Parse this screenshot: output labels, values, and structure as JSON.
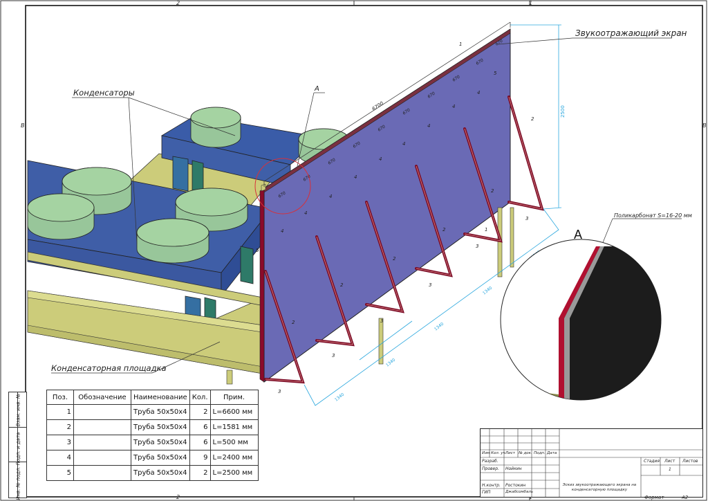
{
  "title_labels": {
    "screen": "Звукоотражающий экран",
    "condensers": "Конденсаторы",
    "platform": "Конденсаторная площадка",
    "detail_letter": "A",
    "polycarbonate": "Поликарбонат S=16-20 мм"
  },
  "dimensions": {
    "length": "6700",
    "height": "2500",
    "step": "670",
    "bay": "1340"
  },
  "position_tags": [
    "1",
    "2",
    "3",
    "4",
    "5"
  ],
  "frame_numbers": {
    "top_2": "2",
    "top_1": "1",
    "left_B": "В"
  },
  "spec": {
    "headers": [
      "Поз.",
      "Обозначение",
      "Наименование",
      "Кол.",
      "Прим."
    ],
    "rows": [
      {
        "pos": "1",
        "designation": "",
        "name": "Труба 50х50х4",
        "qty": "2",
        "note": "L=6600 мм"
      },
      {
        "pos": "2",
        "designation": "",
        "name": "Труба 50х50х4",
        "qty": "6",
        "note": "L=1581 мм"
      },
      {
        "pos": "3",
        "designation": "",
        "name": "Труба 50х50х4",
        "qty": "6",
        "note": "L=500 мм"
      },
      {
        "pos": "4",
        "designation": "",
        "name": "Труба 50х50х4",
        "qty": "9",
        "note": "L=2400 мм"
      },
      {
        "pos": "5",
        "designation": "",
        "name": "Труба 50х50х4",
        "qty": "2",
        "note": "L=2500 мм"
      }
    ]
  },
  "side_stamp": {
    "inv_orig": "Инв. № подл.",
    "sign_date": "Подп. и дата",
    "inv_repl": "Взам. инв. №"
  },
  "title_block": {
    "col_headers": [
      "Изм",
      "Кол. уч.",
      "Лист",
      "№ док.",
      "Подп.",
      "Дата"
    ],
    "roles": [
      "Разраб.",
      "Провер.",
      "Н.контр.",
      "ГИП"
    ],
    "names": [
      "Нойкин",
      "Ростокин",
      "Джабсомбаль"
    ],
    "doc_title": "Эскиз звукоотражающего экрана на конденсаторную площадку",
    "stage_label": "Стадия",
    "sheet_label": "Лист",
    "sheets_label": "Листов",
    "sheet_value": "1",
    "format_label": "Формат",
    "format_value": "А2"
  },
  "colors": {
    "screen_fill": "#6b6bb6",
    "platform_blue": "#3f5fa8",
    "condenser_green": "#9bc899",
    "beam_yellow": "#cccc7a",
    "tube_red": "#8a0a2a",
    "dim_cyan": "#2aa7de"
  }
}
